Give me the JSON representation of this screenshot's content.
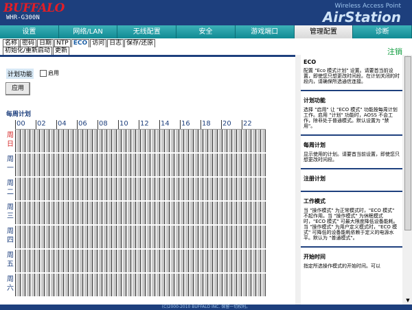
{
  "brand": {
    "logo": "BUFFALO",
    "model": "WHR-G300N",
    "subtitle": "Wireless Access Point",
    "product": "AirStation"
  },
  "main_nav": {
    "tabs": [
      {
        "label": "设置"
      },
      {
        "label": "网络/LAN"
      },
      {
        "label": "无线配置"
      },
      {
        "label": "安全"
      },
      {
        "label": "游戏端口"
      },
      {
        "label": "管理配置",
        "active": true
      },
      {
        "label": "诊断"
      }
    ]
  },
  "sub_nav": {
    "row1": [
      {
        "label": "名称"
      },
      {
        "label": "密码"
      },
      {
        "label": "日期"
      },
      {
        "label": "NTP"
      },
      {
        "label": "ECO",
        "active": true
      },
      {
        "label": "访问"
      },
      {
        "label": "日志"
      },
      {
        "label": "保存/还原"
      }
    ],
    "row2": [
      {
        "label": "初始化/重新启动"
      },
      {
        "label": "更新"
      }
    ]
  },
  "help_link": "注销",
  "content": {
    "plan_label": "计划功能",
    "plan_enable": "启用",
    "apply": "应用",
    "weekly_title": "每周计划",
    "hours": [
      "00",
      "02",
      "04",
      "06",
      "08",
      "10",
      "12",
      "14",
      "16",
      "18",
      "20",
      "22"
    ],
    "days": [
      {
        "chars": [
          "周",
          "日"
        ],
        "is_sunday": true
      },
      {
        "chars": [
          "周",
          "一"
        ]
      },
      {
        "chars": [
          "周",
          "二"
        ]
      },
      {
        "chars": [
          "周",
          "三"
        ]
      },
      {
        "chars": [
          "周",
          "四"
        ]
      },
      {
        "chars": [
          "周",
          "五"
        ]
      },
      {
        "chars": [
          "周",
          "六"
        ]
      }
    ]
  },
  "help": {
    "sections": [
      {
        "title": "ECO",
        "body": "配置 \"Eco 模式计划\" 设置。请要首当前设置，即使您只想更改时间段。在计划关闭的时段内，请确保所选通信连接。"
      },
      {
        "title": "计划功能",
        "body": "选择 \"启用\" 让 \"ECO 模式\" 功能按每周计划工作。启用 \"计划\" 功能时，AOSS 不会工作，除非处于普通模式。默认设置为 \"禁用\"。"
      },
      {
        "title": "每周计划",
        "body": "显示使用的计划。请要首当前设置，即使您只想更改时间段。"
      },
      {
        "title": "注册计划",
        "body": ""
      },
      {
        "title": "工作模式",
        "body": "当 \"操作模式\" 为正常模式时，\"ECO 模式\" 不起作用。当 \"操作模式\" 为休眠模式时，\"ECO 模式\" 可最大限度降低设备能耗。当 \"操作模式\" 为用户定义模式时，\"ECO 模式\" 可降低的设备能耗依赖于定义的电源水平。默认为 \"普通模式\"。"
      },
      {
        "title": "开始时间",
        "body": "指定所选操作模式的开始时间。可以"
      }
    ]
  },
  "footer": "(C)2000-2010 BUFFALO INC. 保留一切权利。"
}
